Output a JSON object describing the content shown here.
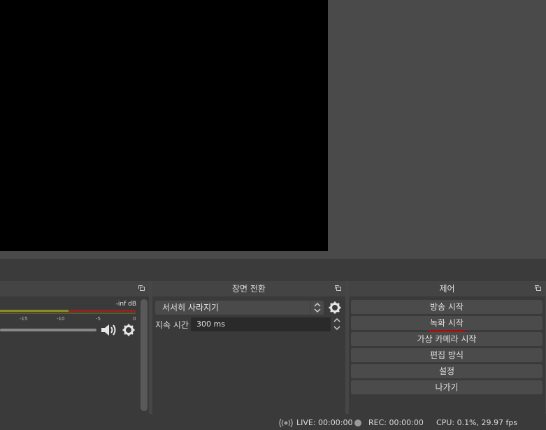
{
  "docks": {
    "mixer": {
      "db_readout": "-inf dB",
      "ticks": [
        "-15",
        "-10",
        "-5",
        "0"
      ]
    },
    "transition": {
      "title": "장면 전환",
      "selected_transition": "서서히 사라지기",
      "duration_label": "지속 시간",
      "duration_value": "300 ms"
    },
    "controls": {
      "title": "제어",
      "buttons": [
        "방송 시작",
        "녹화 시작",
        "가상 카메라 시작",
        "편집 방식",
        "설정",
        "나가기"
      ]
    }
  },
  "status": {
    "live": "LIVE: 00:00:00",
    "rec": "REC: 00:00:00",
    "cpu": "CPU: 0.1%, 29.97 fps"
  },
  "colors": {
    "background": "#464646",
    "dock": "#3a3a3a",
    "preview": "#000000",
    "record_underline": "#d80000"
  },
  "icons": [
    "float-icon",
    "speaker-icon",
    "gear-icon",
    "chevron-up-down-icon",
    "live-signal-icon"
  ]
}
